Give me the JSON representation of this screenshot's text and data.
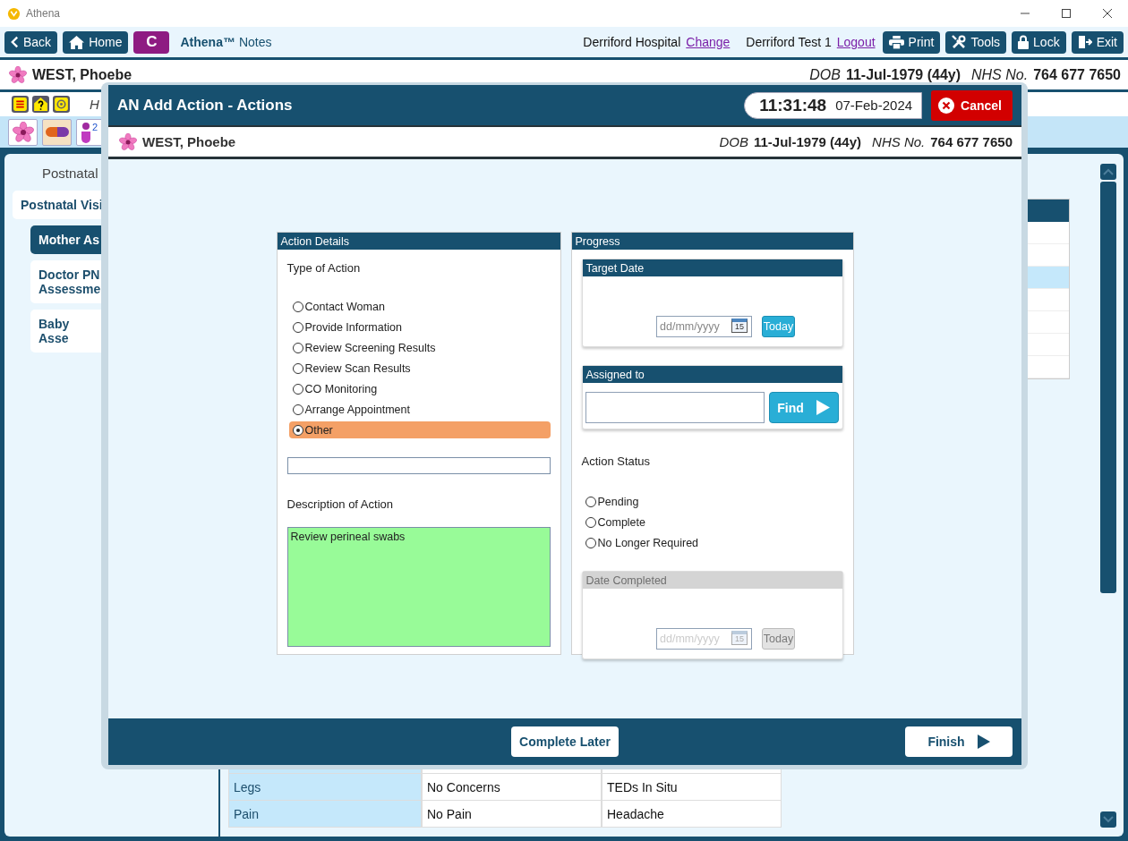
{
  "window": {
    "title": "Athena"
  },
  "toolbar": {
    "left_buttons": [
      {
        "kind": "back",
        "label": "Back"
      },
      {
        "kind": "home",
        "label": "Home"
      },
      {
        "kind": "letter",
        "label": "C"
      }
    ],
    "brand": "Athena™",
    "app_name": "Notes",
    "location": "Derriford Hospital",
    "location_link": "Change",
    "user": "Derriford Test 1",
    "user_link": "Logout",
    "right_buttons": [
      {
        "kind": "print",
        "label": "Print"
      },
      {
        "kind": "tools",
        "label": "Tools"
      },
      {
        "kind": "lock",
        "label": "Lock"
      },
      {
        "kind": "exit",
        "label": "Exit"
      }
    ]
  },
  "patient": {
    "name": "WEST, Phoebe",
    "dob_label": "DOB",
    "dob": "11-Jul-1979 (44y)",
    "nhs_label": "NHS No.",
    "nhs": "764 677 7650"
  },
  "alert_row": {
    "text": "H"
  },
  "icon_row": {
    "count": "2"
  },
  "navigation": {
    "heading": "Postnatal",
    "items": [
      {
        "label": "Postnatal Visi",
        "selected": false,
        "children": [
          {
            "label": "Mother As",
            "selected": true
          },
          {
            "label": "Doctor PN Assessme",
            "selected": false
          },
          {
            "label": "Baby Asse",
            "selected": false
          }
        ]
      }
    ]
  },
  "side_table": {
    "rows": [
      {
        "selected": false
      },
      {
        "selected": false
      },
      {
        "selected": true
      },
      {
        "selected": false
      },
      {
        "selected": false
      },
      {
        "selected": false
      },
      {
        "selected": false
      }
    ]
  },
  "assessment_table": {
    "rows": [
      {
        "cells": [
          "Legs",
          "No Concerns",
          "TEDs In Situ"
        ]
      },
      {
        "cells": [
          "Pain",
          "No Pain",
          "Headache"
        ]
      }
    ]
  },
  "dialog": {
    "title": "AN Add Action - Actions",
    "time": "11:31:48",
    "date": "07-Feb-2024",
    "cancel": "Cancel",
    "patient": {
      "name": "WEST, Phoebe",
      "dob_label": "DOB",
      "dob": "11-Jul-1979 (44y)",
      "nhs_label": "NHS No.",
      "nhs": "764 677 7650"
    },
    "action_details": {
      "title": "Action Details",
      "type_label": "Type of Action",
      "types": [
        {
          "label": "Contact Woman",
          "selected": false
        },
        {
          "label": "Provide Information",
          "selected": false
        },
        {
          "label": "Review Screening Results",
          "selected": false
        },
        {
          "label": "Review Scan Results",
          "selected": false
        },
        {
          "label": "CO Monitoring",
          "selected": false
        },
        {
          "label": "Arrange Appointment",
          "selected": false
        },
        {
          "label": "Other",
          "selected": true
        }
      ],
      "description_label": "Description of Action",
      "description": "Review perineal swabs"
    },
    "progress": {
      "title": "Progress",
      "target_date": {
        "title": "Target Date",
        "placeholder": "dd/mm/yyyy",
        "calendar": "15",
        "today": "Today",
        "disabled": false
      },
      "assigned": {
        "title": "Assigned to",
        "find": "Find"
      },
      "status_label": "Action Status",
      "statuses": [
        {
          "label": "Pending",
          "selected": false
        },
        {
          "label": "Complete",
          "selected": false
        },
        {
          "label": "No Longer Required",
          "selected": false
        }
      ],
      "date_completed": {
        "title": "Date Completed",
        "placeholder": "dd/mm/yyyy",
        "calendar": "15",
        "today": "Today",
        "disabled": true
      }
    },
    "footer": {
      "complete_later": "Complete Later",
      "finish": "Finish"
    }
  }
}
